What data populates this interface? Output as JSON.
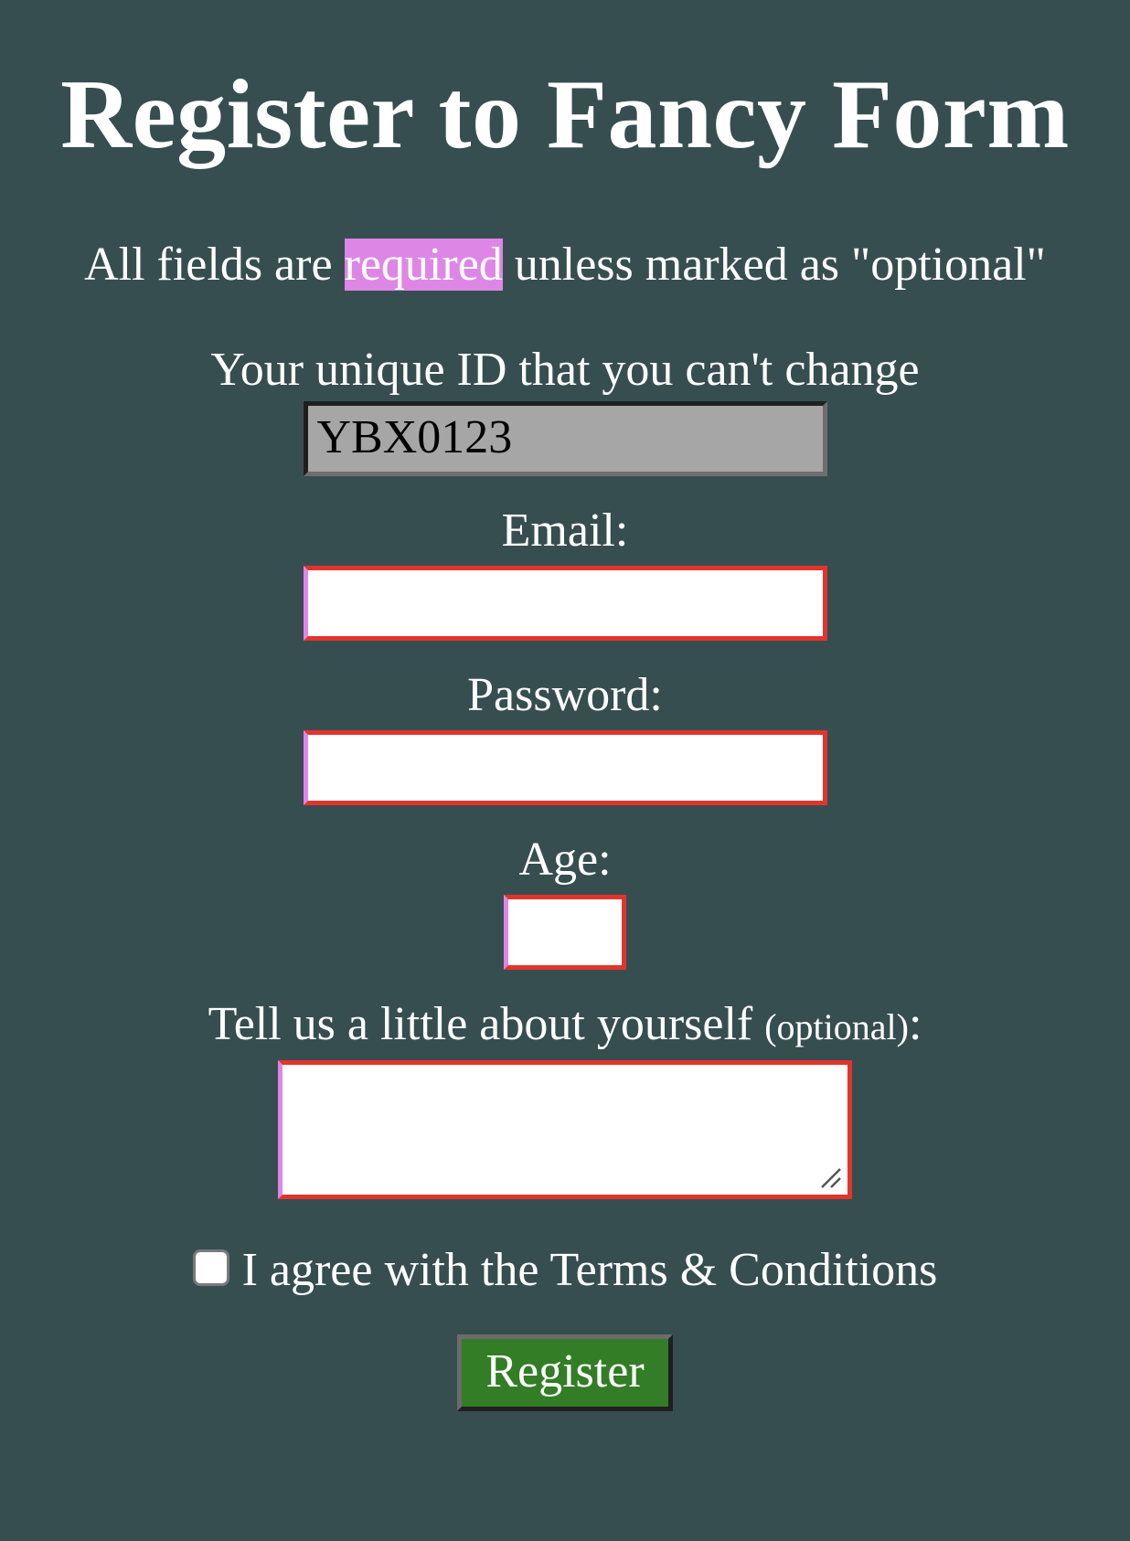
{
  "page": {
    "title": "Register to Fancy Form",
    "intro_before": "All fields are ",
    "intro_highlight": "required",
    "intro_after": " unless marked as \"optional\""
  },
  "fields": {
    "id": {
      "label": "Your unique ID that you can't change",
      "value": "YBX0123"
    },
    "email": {
      "label": "Email:",
      "value": ""
    },
    "password": {
      "label": "Password:",
      "value": ""
    },
    "age": {
      "label": "Age:",
      "value": ""
    },
    "about": {
      "label": "Tell us a little about yourself ",
      "optional": "(optional)",
      "suffix": ":",
      "value": ""
    }
  },
  "terms": {
    "label": "I agree with the Terms & Conditions",
    "checked": false
  },
  "submit": {
    "label": "Register"
  },
  "colors": {
    "background": "#374e51",
    "highlight": "#de86e6",
    "error_border": "#e3342c",
    "button": "#327d25",
    "readonly_field": "#a6a6a6"
  }
}
